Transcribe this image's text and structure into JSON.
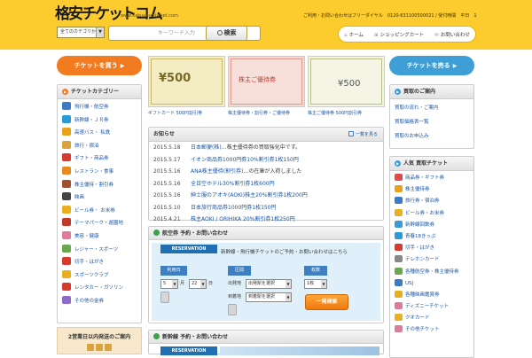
{
  "header": {
    "logo_text": "格安チケットコム",
    "logo_url": "www.kakuyasu-ticket.com",
    "tagline": "ご利用・お問い合わせはフリーダイヤル　0120-631100500021 / 受付時間　平日　10時～19時",
    "category_select": "全てのカテゴリから",
    "search_placeholder": "キーワード入力",
    "search_button": "検索",
    "nav": [
      {
        "icon": "home-icon",
        "glyph": "⌂",
        "label": "ホーム"
      },
      {
        "icon": "cart-icon",
        "glyph": "⊞",
        "label": "ショッピングカート"
      },
      {
        "icon": "mail-icon",
        "glyph": "✉",
        "label": "お問い合わせ"
      }
    ]
  },
  "buy": {
    "banner": "チケットを買う",
    "categories_title": "チケットカテゴリー",
    "categories": [
      {
        "label": "飛行機・航空券",
        "color": "#3a7bc8"
      },
      {
        "label": "新幹線・ＪＲ券",
        "color": "#2a9bd7"
      },
      {
        "label": "高速バス・ 私鉄",
        "color": "#e8a31a"
      },
      {
        "label": "旅行・宿泊",
        "color": "#d9a23a"
      },
      {
        "label": "ギフト・商品券",
        "color": "#d63b2f"
      },
      {
        "label": "レストラン・食事",
        "color": "#e88a20"
      },
      {
        "label": "株主優待・割引券",
        "color": "#a0522d"
      },
      {
        "label": "映画",
        "color": "#444444"
      },
      {
        "label": "ビール券・ お米券",
        "color": "#e8b020"
      },
      {
        "label": "テーマパーク・遊園地",
        "color": "#c0392b"
      },
      {
        "label": "美容・健康",
        "color": "#e07a9a"
      },
      {
        "label": "レジャー・スポーツ",
        "color": "#6aa84f"
      },
      {
        "label": "切手・はがき",
        "color": "#d63b2f"
      },
      {
        "label": "スポーツクラブ",
        "color": "#e8b020"
      },
      {
        "label": "レンタカー・ガソリン",
        "color": "#d63b2f"
      },
      {
        "label": "その他の金券",
        "color": "#8e6bc6"
      }
    ]
  },
  "promo": {
    "title": "2営業日以内発送のご案内"
  },
  "tickets": [
    {
      "caption": "ギフトカード 500円割引券",
      "price": "¥500"
    },
    {
      "caption": "株主優待券・割引券・ご優待券",
      "price": "株主ご優待券"
    },
    {
      "caption": "株主ご優待券 500円割引券",
      "price": "¥500"
    }
  ],
  "news": {
    "title": "お知らせ",
    "list_button": "一覧を見る",
    "items": [
      {
        "date": "2015.5.18",
        "link": "日本郵便(株)",
        "text": "…株主優待券の買取強化中です。"
      },
      {
        "date": "2015.5.17",
        "link": "イオン商品券1000円券10%割引券1枚150円",
        "text": ""
      },
      {
        "date": "2015.5.16",
        "link": "ANA株主優待(割引券)",
        "text": "…の在庫が入荷しました"
      },
      {
        "date": "2015.5.16",
        "link": "全日空ホテル30%割引券1枚600円",
        "text": ""
      },
      {
        "date": "2015.5.16",
        "link": "紳士服のアオキ(AOKI)株主20%割引券1枚200円",
        "text": ""
      },
      {
        "date": "2015.5.10",
        "link": "日本旅行商品券1000円券1枚150円",
        "text": ""
      },
      {
        "date": "2015.4.21",
        "link": "株主AOKI / ORIHIKA 20%割引券1枚250円",
        "text": ""
      }
    ]
  },
  "reservation": {
    "title": "航空券 予約・お問い合わせ",
    "tag": "RESERVATION",
    "text": "新幹線・飛行機チケットのご予約・お問い合わせはこちら",
    "labels": [
      "利用日",
      "区間",
      "枚数"
    ],
    "month": "5",
    "day": "22",
    "from_label": "出発地",
    "to_label": "到着地",
    "from_select": "出発駅を選択",
    "to_select": "到着駅を選択",
    "count_select": "1枚",
    "button": "一発検索"
  },
  "reservation2": {
    "title": "新幹線 予約・お問い合わせ",
    "tag": "RESERVATION"
  },
  "sell": {
    "banner": "チケットを売る",
    "guide_title": "買取のご案内",
    "guide": [
      "買取の流れ・ご案内",
      "買取価格表一覧",
      "買取のお申込み"
    ],
    "popular_title": "人気 買取チケット",
    "popular": [
      {
        "label": "商品券・ギフト券",
        "color": "#e04a4a"
      },
      {
        "label": "株主優待券",
        "color": "#e8a31a"
      },
      {
        "label": "旅行券・宿泊券",
        "color": "#3a7bc8"
      },
      {
        "label": "ビール券・お米券",
        "color": "#e8b020"
      },
      {
        "label": "新幹線回数券",
        "color": "#3a9bd7"
      },
      {
        "label": "青春18きっぷ",
        "color": "#2a9bd7"
      },
      {
        "label": "切手・はがき",
        "color": "#d63b2f"
      },
      {
        "label": "テレホンカード",
        "color": "#888888"
      },
      {
        "label": "各種航空券・株主優待券",
        "color": "#6aa84f"
      },
      {
        "label": "USJ",
        "color": "#3a7bc8"
      },
      {
        "label": "各種映画鑑賞券",
        "color": "#e8b020"
      },
      {
        "label": "ディズニーチケット",
        "color": "#e07a9a"
      },
      {
        "label": "クオカード",
        "color": "#e8b020"
      },
      {
        "label": "その他チケット",
        "color": "#e07a9a"
      }
    ]
  },
  "colors": {
    "header_bg": "#fccb2e",
    "buy_accent": "#f27a1f",
    "sell_accent": "#3e9fd6",
    "link": "#1a55a5"
  }
}
